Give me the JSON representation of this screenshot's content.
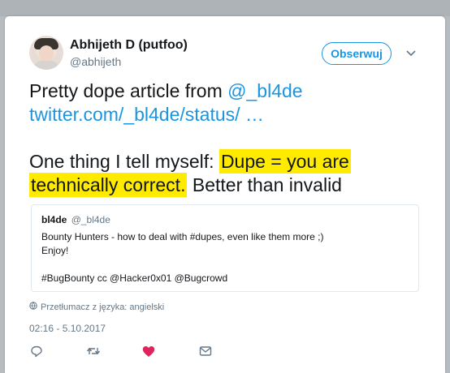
{
  "author": {
    "name": "Abhijeth D (putfoo)",
    "handle": "@abhijeth"
  },
  "follow_button": {
    "label": "Obserwuj"
  },
  "tweet": {
    "text_part1": "Pretty dope article from ",
    "mention": "@_bl4de",
    "link": "twitter.com/_bl4de/status/ …",
    "line3_pre": "One thing I tell myself: ",
    "highlight1": "Dupe = you are",
    "highlight2": "technically correct.",
    "line4_post": " Better than invalid"
  },
  "quoted_tweet": {
    "name": "bl4de",
    "handle": "@_bl4de",
    "line1": "Bounty Hunters - how to deal with #dupes, even like them more ;)",
    "line2": "Enjoy!",
    "line3": "#BugBounty cc @Hacker0x01 @Bugcrowd"
  },
  "translate": {
    "label": "Przetłumacz z języka: angielski"
  },
  "timestamp": "02:16 - 5.10.2017",
  "actions": {
    "reply_icon": "reply-icon",
    "retweet_icon": "retweet-icon",
    "like_icon": "heart-icon",
    "dm_icon": "envelope-icon",
    "like_color": "#e0245e"
  },
  "colors": {
    "accent": "#1b95e0",
    "highlight": "#ffeb00",
    "secondary_text": "#657786"
  }
}
